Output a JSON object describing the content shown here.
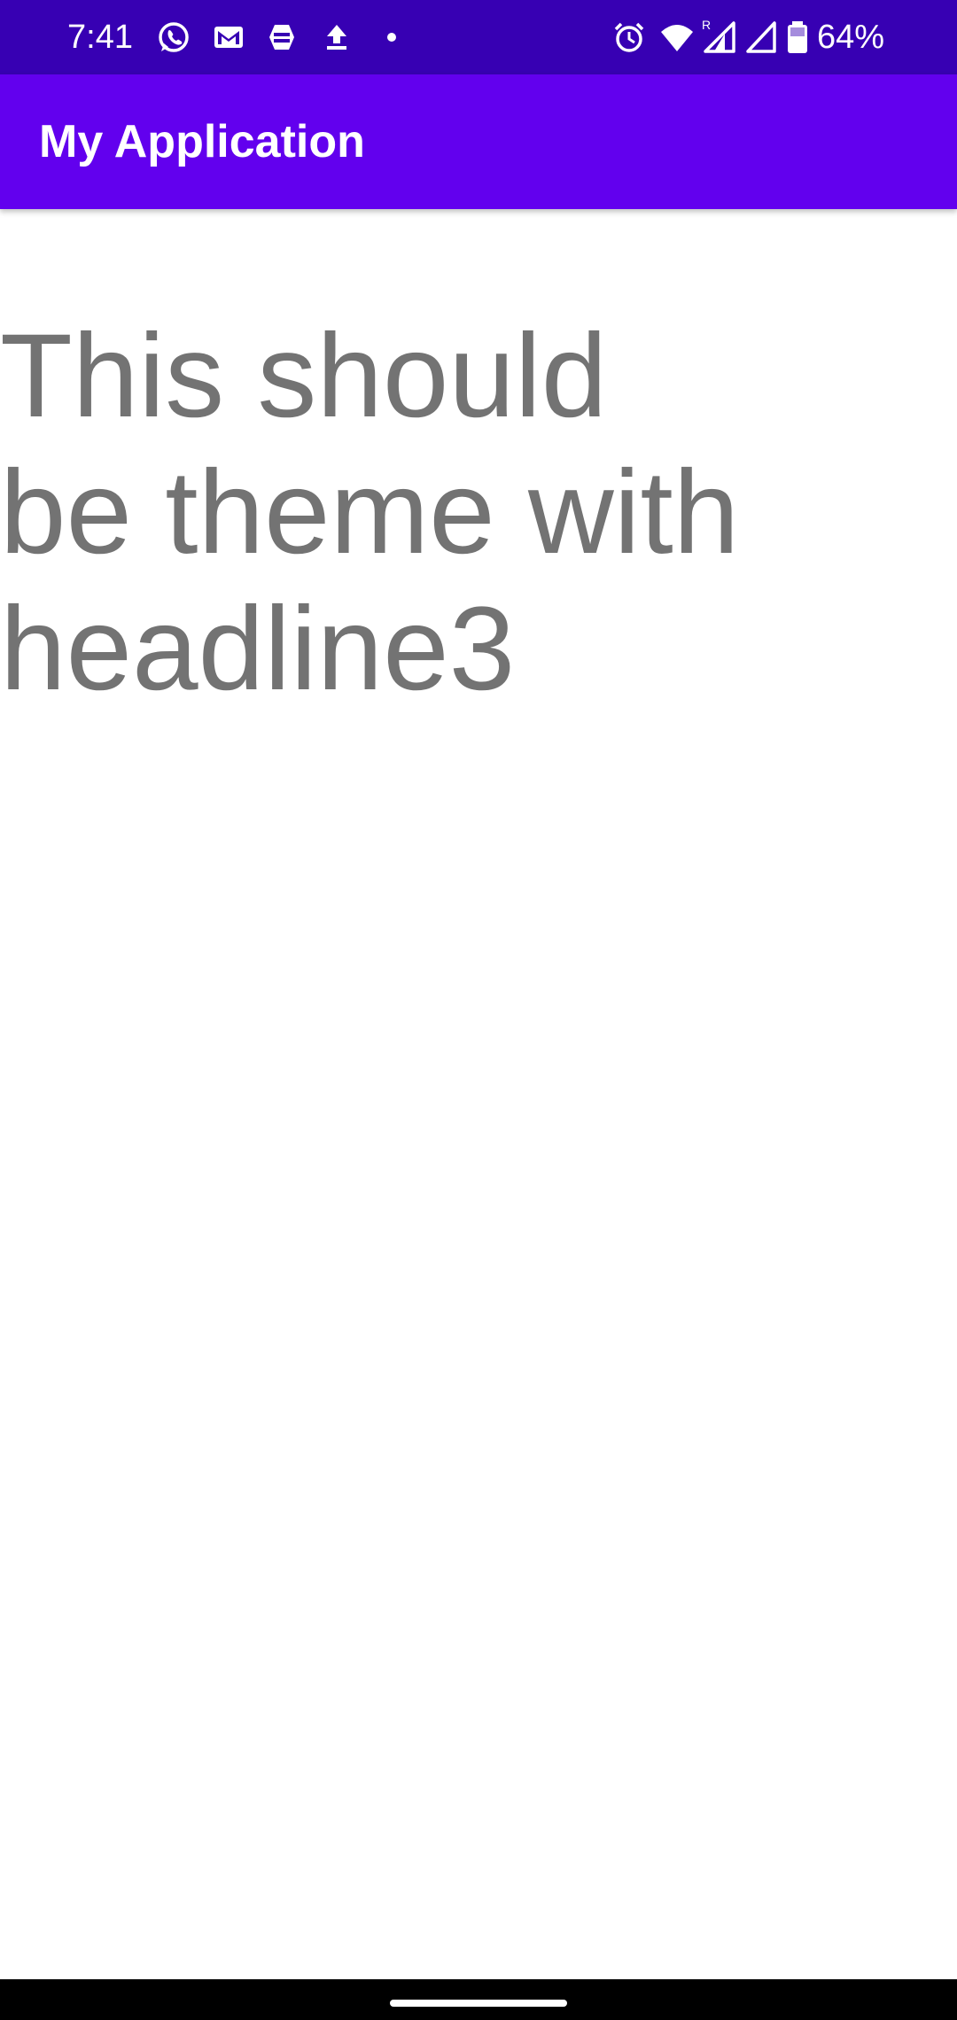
{
  "status_bar": {
    "time": "7:41",
    "battery_percent": "64%",
    "background_color": "#3700B3",
    "left_icons": [
      "whatsapp-icon",
      "gmail-icon",
      "notification-app-icon",
      "upload-icon",
      "more-notifications-dot-icon"
    ],
    "right_icons": [
      "alarm-icon",
      "wifi-icon",
      "signal-roaming-icon",
      "signal-icon",
      "battery-icon"
    ],
    "roaming_indicator": "R"
  },
  "app_bar": {
    "title": "My Application",
    "background_color": "#6200EE"
  },
  "content": {
    "headline_lines": [
      "This should",
      "be theme with",
      "headline3"
    ],
    "text_color": "#737373"
  },
  "nav_bar": {
    "background_color": "#000000"
  }
}
